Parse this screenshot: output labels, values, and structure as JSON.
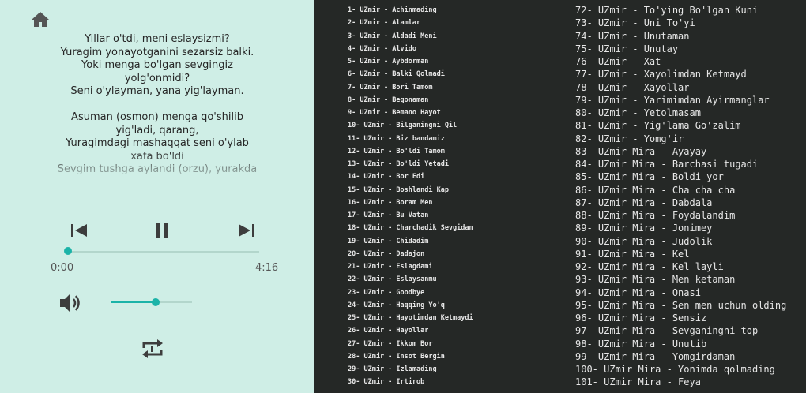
{
  "player": {
    "lyrics": [
      "Yillar o'tdi, meni eslaysizmi?",
      "Yuragim yonayotganini sezarsiz balki.",
      "Yoki menga bo'lgan sevgingiz",
      "yolg'onmidi?",
      "Seni o'ylayman, yana yig'layman.",
      "",
      "Asuman (osmon) menga qo'shilib",
      "yig'ladi, qarang,",
      "Yuragimdagi mashaqqat seni o'ylab",
      "xafa bo'ldi",
      "Sevgim tushga aylandi (orzu), yurakda"
    ],
    "time_elapsed": "0:00",
    "time_total": "4:16",
    "progress_fraction": 0.0,
    "volume_fraction": 0.55,
    "accent_color": "#1bb3a8",
    "panel_color": "#cfeee6"
  },
  "tracks_left": [
    "1- UZmir - Achinmading",
    "2- UZmir - Alamlar",
    "3- UZmir - Aldadi Meni",
    "4- UZmir - Alvido",
    "5- UZmir - Aybdorman",
    "6- UZmir - Balki Qolmadi",
    "7- UZmir - Bori Tamom",
    "8- UZmir - Begonaman",
    "9- UZmir - Bemano Hayot",
    "10- UZmir - Bilganingni Qil",
    "11- UZmir - Biz bandamiz",
    "12- UZmir - Bo'ldi Tamom",
    "13- UZmir - Bo'ldi Yetadi",
    "14- UZmir - Bor Edi",
    "15- UZmir - Boshlandi Kap",
    "16- UZmir - Boram Men",
    "17- UZmir - Bu Vatan",
    "18- UZmir - Charchadik Sevgidan",
    "19- UZmir - Chidadim",
    "20- UZmir - Dadajon",
    "21- UZmir - Eslagdami",
    "22- UZmir - Eslaysanmu",
    "23- UZmir - Goodbye",
    "24- UZmir - Haqqing Yo'q",
    "25- UZmir - Hayotimdan Ketmaydi",
    "26- UZmir - Hayollar",
    "27- UZmir - Ikkom Bor",
    "28- UZmir - Insot Bergin",
    "29- UZmir - Izlamading",
    "30- UZmir - Irtirob"
  ],
  "tracks_right": [
    "72- UZmir - To'ying Bo'lgan Kuni",
    "73- UZmir - Uni To'yi",
    "74- UZmir - Unutaman",
    "75- UZmir - Unutay",
    "76- UZmir - Xat",
    "77- UZmir - Xayolimdan Ketmayd",
    "78- UZmir - Xayollar",
    "79- UZmir - Yarimimdan Ayirmanglar",
    "80- UZmir - Yetolmasam",
    "81- UZmir - Yig'lama Go'zalim",
    "82- UZmir - Yomg'ir",
    "83- UZmir Mira - Ayayay",
    "84- UZmir Mira - Barchasi tugadi",
    "85- UZmir Mira - Boldi yor",
    "86- UZmir Mira - Cha cha cha",
    "87- UZmir Mira - Dabdala",
    "88- UZmir Mira - Foydalandim",
    "89- UZmir Mira - Jonimey",
    "90- UZmir Mira - Judolik",
    "91- UZmir Mira - Kel",
    "92- UZmir Mira - Kel layli",
    "93- UZmir Mira - Men ketaman",
    "94- UZmir Mira - Onasi",
    "95- UZmir Mira - Sen men uchun olding",
    "96- UZmir Mira - Sensiz",
    "97- UZmir Mira - Sevganingni top",
    "98- UZmir Mira - Unutib",
    "99- UZmir Mira - Yomgirdaman",
    "100- UZmir Mira - Yonimda qolmading",
    "101- UZmir Mira - Feya"
  ]
}
